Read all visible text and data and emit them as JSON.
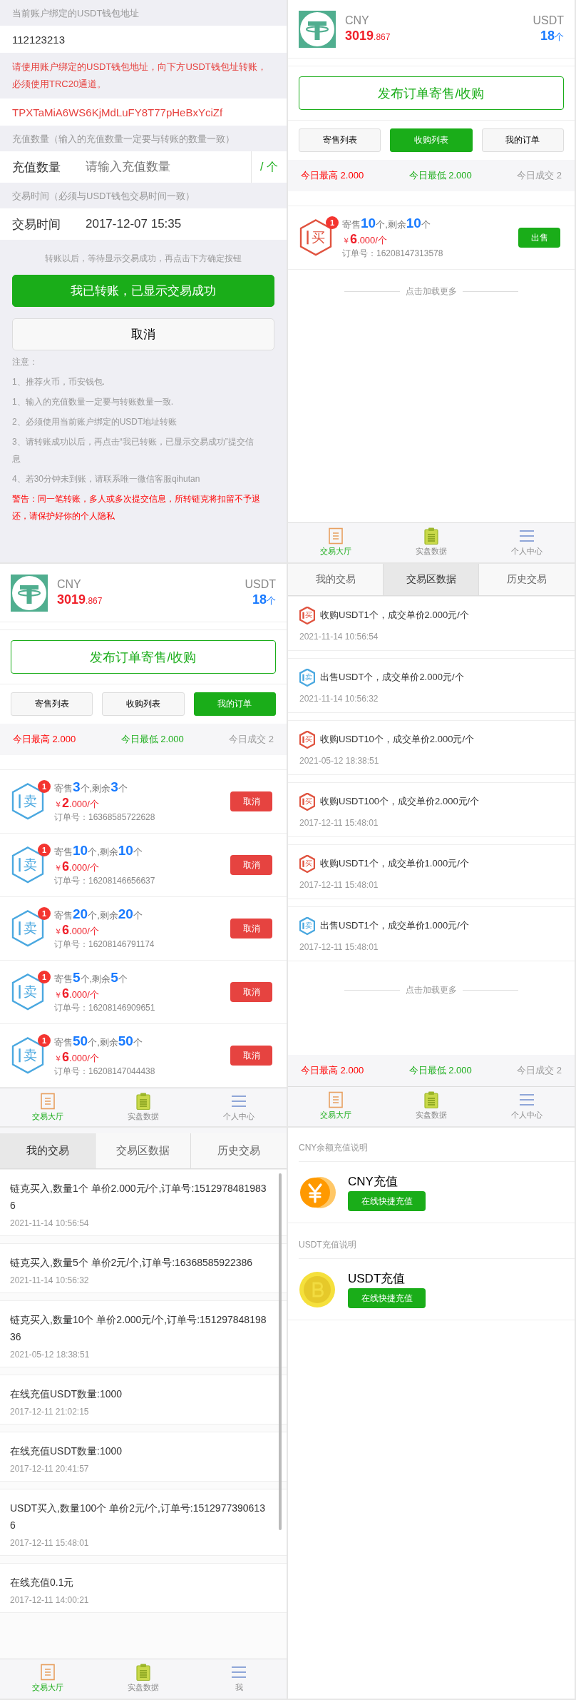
{
  "rows": [
    {
      "panels": [
        {
          "kind": "recharge",
          "wallet_label": "当前账户绑定的USDT钱包地址",
          "wallet": "112123213",
          "notice": "请使用账户绑定的USDT钱包地址，向下方USDT钱包址转账，必须使用TRC20通道。",
          "address": "TPXTaMiA6WS6KjMdLuFY8T77pHeBxYciZf",
          "amount_label": "充值数量（输入的充值数量一定要与转账的数量一致）",
          "amount_field": {
            "label": "充值数量",
            "placeholder": "请输入充值数量",
            "unit": "/ 个"
          },
          "time_label": "交易时间（必须与USDT钱包交易时间一致）",
          "time_field": {
            "label": "交易时间",
            "value": "2017-12-07 15:35"
          },
          "hint": "转账以后，等待显示交易成功，再点击下方确定按钮",
          "confirm": "我已转账，已显示交易成功",
          "cancel": "取消",
          "notes_title": "注意：",
          "notes": [
            "1、推荐火币，币安钱包.",
            "1、输入的充值数量一定要与转账数量一致.",
            "2、必须使用当前账户绑定的USDT地址转账",
            "3、请转账成功以后，再点击“我已转账，已显示交易成功”提交信息",
            "4、若30分钟未到账，请联系唯一微信客服qihutan"
          ],
          "warning": "警告：同一笔转账，多人或多次提交信息，所转链克将扣留不予退还，请保护好你的个人隐私"
        },
        {
          "kind": "market",
          "cny": {
            "label": "CNY",
            "integer": "3019",
            "decimal": ".867"
          },
          "usdt": {
            "label": "USDT",
            "amount": "18",
            "unit": "个"
          },
          "publish": "发布订单寄售/收购",
          "tabs": [
            {
              "label": "寄售列表",
              "selected": false
            },
            {
              "label": "收购列表",
              "selected": true
            },
            {
              "label": "我的订单",
              "selected": false
            }
          ],
          "stats": [
            "今日最高 2.000",
            "今日最低 2.000",
            "今日成交 2"
          ],
          "orders": [
            {
              "color": "#e0533f",
              "icon_char": "买",
              "count": "1",
              "quantity": [
                "寄售",
                "10",
                "个,剩余",
                "10",
                "个"
              ],
              "price": [
                "￥",
                "6",
                ".000/个"
              ],
              "order_no": "订单号：16208147313578",
              "action": {
                "label": "出售",
                "kind": "sell"
              }
            }
          ],
          "load_more": "点击加载更多",
          "nav": [
            {
              "label": "交易大厅",
              "selected": true
            },
            {
              "label": "实盘数据",
              "selected": false
            },
            {
              "label": "个人中心",
              "selected": false
            }
          ]
        }
      ]
    },
    {
      "panels": [
        {
          "kind": "market",
          "cny": {
            "label": "CNY",
            "integer": "3019",
            "decimal": ".867"
          },
          "usdt": {
            "label": "USDT",
            "amount": "18",
            "unit": "个"
          },
          "publish": "发布订单寄售/收购",
          "tabs": [
            {
              "label": "寄售列表",
              "selected": false
            },
            {
              "label": "收购列表",
              "selected": false
            },
            {
              "label": "我的订单",
              "selected": true
            }
          ],
          "stats": [
            "今日最高 2.000",
            "今日最低 2.000",
            "今日成交 2"
          ],
          "orders": [
            {
              "color": "#4aa8e0",
              "icon_char": "卖",
              "count": "1",
              "quantity": [
                "寄售",
                "3",
                "个,剩余",
                "3",
                "个"
              ],
              "price": [
                "￥",
                "2",
                ".000/个"
              ],
              "order_no": "订单号：16368585722628",
              "action": {
                "label": "取消",
                "kind": "cancel"
              }
            },
            {
              "color": "#4aa8e0",
              "icon_char": "卖",
              "count": "1",
              "quantity": [
                "寄售",
                "10",
                "个,剩余",
                "10",
                "个"
              ],
              "price": [
                "￥",
                "6",
                ".000/个"
              ],
              "order_no": "订单号：16208146656637",
              "action": {
                "label": "取消",
                "kind": "cancel"
              }
            },
            {
              "color": "#4aa8e0",
              "icon_char": "卖",
              "count": "1",
              "quantity": [
                "寄售",
                "20",
                "个,剩余",
                "20",
                "个"
              ],
              "price": [
                "￥",
                "6",
                ".000/个"
              ],
              "order_no": "订单号：16208146791174",
              "action": {
                "label": "取消",
                "kind": "cancel"
              }
            },
            {
              "color": "#4aa8e0",
              "icon_char": "卖",
              "count": "1",
              "quantity": [
                "寄售",
                "5",
                "个,剩余",
                "5",
                "个"
              ],
              "price": [
                "￥",
                "6",
                ".000/个"
              ],
              "order_no": "订单号：16208146909651",
              "action": {
                "label": "取消",
                "kind": "cancel"
              }
            },
            {
              "color": "#4aa8e0",
              "icon_char": "卖",
              "count": "1",
              "quantity": [
                "寄售",
                "50",
                "个,剩余",
                "50",
                "个"
              ],
              "price": [
                "￥",
                "6",
                ".000/个"
              ],
              "order_no": "订单号：16208147044438",
              "action": {
                "label": "取消",
                "kind": "cancel"
              }
            }
          ],
          "nav": [
            {
              "label": "交易大厅",
              "selected": true
            },
            {
              "label": "实盘数据",
              "selected": false
            },
            {
              "label": "个人中心",
              "selected": false
            }
          ]
        },
        {
          "kind": "trades",
          "tabs": [
            {
              "label": "我的交易",
              "selected": false
            },
            {
              "label": "交易区数据",
              "selected": true
            },
            {
              "label": "历史交易",
              "selected": false
            }
          ],
          "trades": [
            {
              "color": "#e0533f",
              "icon_char": "买",
              "text": "收购USDT1个，成交单价2.000元/个",
              "time": "2021-11-14 10:56:54"
            },
            {
              "color": "#4aa8e0",
              "icon_char": "卖",
              "text": "出售USDT个，成交单价2.000元/个",
              "time": "2021-11-14 10:56:32"
            },
            {
              "color": "#e0533f",
              "icon_char": "买",
              "text": "收购USDT10个，成交单价2.000元/个",
              "time": "2021-05-12 18:38:51"
            },
            {
              "color": "#e0533f",
              "icon_char": "买",
              "text": "收购USDT100个，成交单价2.000元/个",
              "time": "2017-12-11 15:48:01"
            },
            {
              "color": "#e0533f",
              "icon_char": "买",
              "text": "收购USDT1个，成交单价1.000元/个",
              "time": "2017-12-11 15:48:01"
            },
            {
              "color": "#4aa8e0",
              "icon_char": "卖",
              "text": "出售USDT1个，成交单价1.000元/个",
              "time": "2017-12-11 15:48:01"
            }
          ],
          "load_more": "点击加载更多",
          "stats": [
            "今日最高 2.000",
            "今日最低 2.000",
            "今日成交 2"
          ],
          "nav": [
            {
              "label": "交易大厅",
              "selected": true
            },
            {
              "label": "实盘数据",
              "selected": false
            },
            {
              "label": "个人中心",
              "selected": false
            }
          ]
        }
      ]
    },
    {
      "panels": [
        {
          "kind": "history",
          "tabs": [
            {
              "label": "我的交易",
              "selected": true
            },
            {
              "label": "交易区数据",
              "selected": false
            },
            {
              "label": "历史交易",
              "selected": false
            }
          ],
          "records": [
            {
              "text": "链克买入,数量1个 单价2.000元/个,订单号:15129784819836",
              "time": "2021-11-14 10:56:54"
            },
            {
              "text": "链克买入,数量5个 单价2元/个,订单号:16368585922386",
              "time": "2021-11-14 10:56:32"
            },
            {
              "text": "链克买入,数量10个 单价2.000元/个,订单号:15129784819836",
              "time": "2021-05-12 18:38:51"
            },
            {
              "text": "在线充值USDT数量:1000",
              "time": "2017-12-11 21:02:15"
            },
            {
              "text": "在线充值USDT数量:1000",
              "time": "2017-12-11 20:41:57"
            },
            {
              "text": "USDT买入,数量100个 单价2元/个,订单号:15129773906136",
              "time": "2017-12-11 15:48:01"
            },
            {
              "text": "在线充值0.1元",
              "time": "2017-12-11 14:00:21"
            }
          ],
          "nav": [
            {
              "label": "交易大厅",
              "selected": true
            },
            {
              "label": "实盘数据",
              "selected": false
            },
            {
              "label": "我",
              "selected": false
            }
          ]
        },
        {
          "kind": "topup",
          "sections": [
            {
              "heading": "CNY余额充值说明",
              "title": "CNY充值",
              "button": "在线快捷充值"
            },
            {
              "heading": "USDT充值说明",
              "title": "USDT充值",
              "button": "在线快捷充值"
            }
          ]
        }
      ]
    }
  ]
}
